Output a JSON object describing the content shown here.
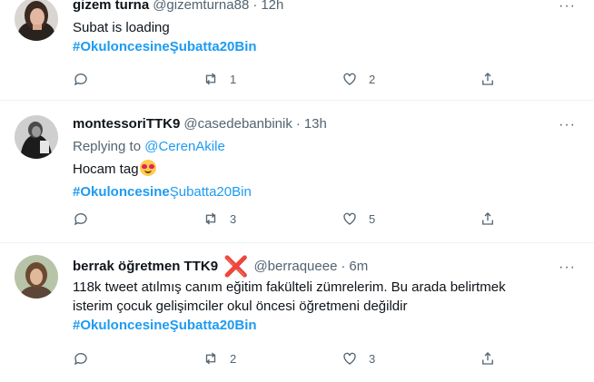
{
  "tweets": [
    {
      "name": "gizem turna",
      "handle": "@gizemturna88",
      "dot": "·",
      "time": "12h",
      "lines": [
        "Subat is loading"
      ],
      "hashtag": "#OkuloncesineŞubatta20Bin",
      "replies": "",
      "retweets": "1",
      "likes": "2"
    },
    {
      "name": "montessoriTTK9",
      "handle": "@casedebanbinik",
      "dot": "·",
      "time": "13h",
      "replying_prefix": "Replying to",
      "replying_mention": "@CerenAkile",
      "lines": [
        "Hocam tag"
      ],
      "emoji": "heart-eyes-emoji",
      "hashtag_bold": "#Okuloncesine",
      "hashtag_light": "Şubatta20Bin",
      "replies": "",
      "retweets": "3",
      "likes": "5"
    },
    {
      "name": "berrak öğretmen TTK9",
      "cross": "❌",
      "handle": "@berraqueee",
      "dot": "·",
      "time": "6m",
      "lines": [
        "118k tweet atılmış canım eğitim fakülteli zümrelerim. Bu arada belirtmek",
        "isterim çocuk gelişimciler okul öncesi öğretmeni değildir"
      ],
      "hashtag": "#OkuloncesineŞubatta20Bin",
      "replies": "",
      "retweets": "2",
      "likes": "3"
    }
  ],
  "more_glyph": "···",
  "icons": [
    "reply-icon",
    "retweet-icon",
    "like-icon",
    "share-icon",
    "more-icon"
  ],
  "colors": {
    "link": "#1d9bf0",
    "muted": "#536471",
    "text": "#0f1419"
  }
}
